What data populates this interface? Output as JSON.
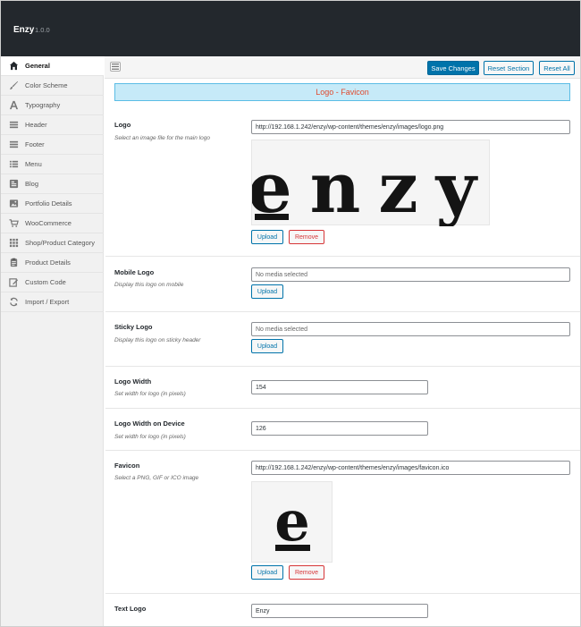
{
  "app": {
    "name": "Enzy",
    "version": "1.0.0"
  },
  "sidebar": {
    "items": [
      {
        "label": "General",
        "icon": "home-icon",
        "active": true
      },
      {
        "label": "Color Scheme",
        "icon": "brush-icon"
      },
      {
        "label": "Typography",
        "icon": "typography-icon"
      },
      {
        "label": "Header",
        "icon": "header-icon"
      },
      {
        "label": "Footer",
        "icon": "footer-icon"
      },
      {
        "label": "Menu",
        "icon": "menu-list-icon"
      },
      {
        "label": "Blog",
        "icon": "blog-icon"
      },
      {
        "label": "Portfolio Details",
        "icon": "image-icon"
      },
      {
        "label": "WooCommerce",
        "icon": "cart-icon"
      },
      {
        "label": "Shop/Product Category",
        "icon": "grid-icon"
      },
      {
        "label": "Product Details",
        "icon": "clipboard-icon"
      },
      {
        "label": "Custom Code",
        "icon": "edit-icon"
      },
      {
        "label": "Import / Export",
        "icon": "refresh-icon"
      }
    ]
  },
  "toolbar": {
    "save_label": "Save Changes",
    "reset_section_label": "Reset Section",
    "reset_all_label": "Reset All"
  },
  "section": {
    "title": "Logo - Favicon"
  },
  "fields": {
    "logo": {
      "label": "Logo",
      "desc": "Select an image file for the main logo",
      "value": "http://192.168.1.242/enzy/wp-content/themes/enzy/images/logo.png",
      "preview_text": "enzy",
      "upload": "Upload",
      "remove": "Remove"
    },
    "mobile_logo": {
      "label": "Mobile Logo",
      "desc": "Display this logo on mobile",
      "placeholder": "No media selected",
      "upload": "Upload"
    },
    "sticky_logo": {
      "label": "Sticky Logo",
      "desc": "Display this logo on sticky header",
      "placeholder": "No media selected",
      "upload": "Upload"
    },
    "logo_width": {
      "label": "Logo Width",
      "desc": "Set width for logo (in pixels)",
      "value": "154"
    },
    "logo_width_device": {
      "label": "Logo Width on Device",
      "desc": "Set width for logo (in pixels)",
      "value": "126"
    },
    "favicon": {
      "label": "Favicon",
      "desc": "Select a PNG, GIF or ICO image",
      "value": "http://192.168.1.242/enzy/wp-content/themes/enzy/images/favicon.ico",
      "preview_text": "e",
      "upload": "Upload",
      "remove": "Remove"
    },
    "text_logo": {
      "label": "Text Logo",
      "value": "Enzy"
    }
  },
  "colors": {
    "topbar": "#23282d",
    "primary": "#0073aa",
    "danger": "#d63638",
    "banner_bg": "#c6eaf8",
    "banner_text": "#e04a2f"
  }
}
